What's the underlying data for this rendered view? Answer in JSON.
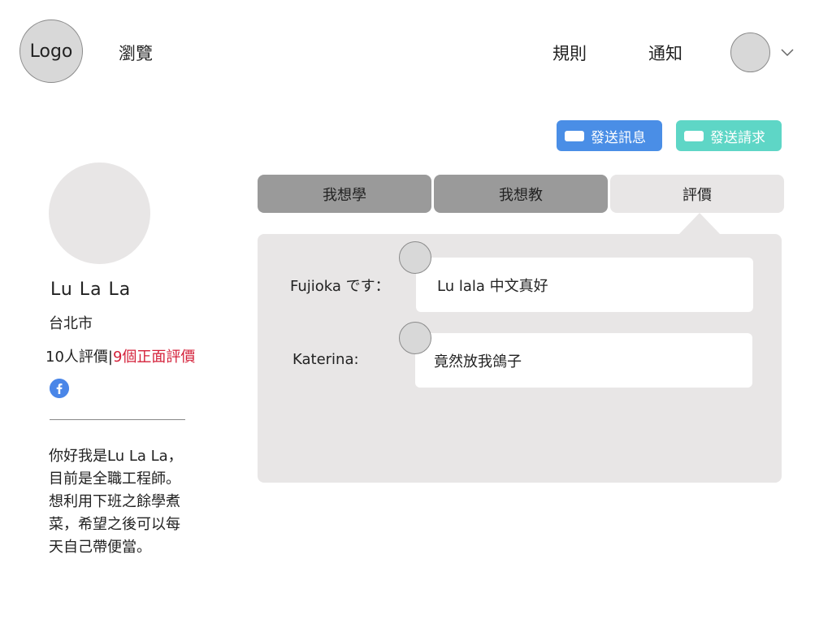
{
  "header": {
    "logo_text": "Logo",
    "nav_browse": "瀏覽",
    "nav_rules": "規則",
    "nav_notifications": "通知"
  },
  "actions": {
    "send_message": "發送訊息",
    "send_request": "發送請求",
    "colors": {
      "message": "#4a8ee6",
      "request": "#5ed6c6"
    }
  },
  "profile": {
    "name": "Lu La La",
    "city": "台北市",
    "review_count_text": "10人評價",
    "separator": "|",
    "positive_reviews_text": "9個正面評價",
    "positive_color": "#d4213a",
    "social_icon": "facebook-icon",
    "bio": "你好我是Lu La La，目前是全職工程師。想利用下班之餘學煮菜，希望之後可以每天自己帶便當。"
  },
  "tabs": [
    {
      "label": "我想學",
      "active": false
    },
    {
      "label": "我想教",
      "active": false
    },
    {
      "label": "評價",
      "active": true
    }
  ],
  "reviews": [
    {
      "author": "Fujioka です：",
      "text": "Lu lala 中文真好"
    },
    {
      "author": "Katerina:",
      "text": "竟然放我鴿子"
    }
  ]
}
